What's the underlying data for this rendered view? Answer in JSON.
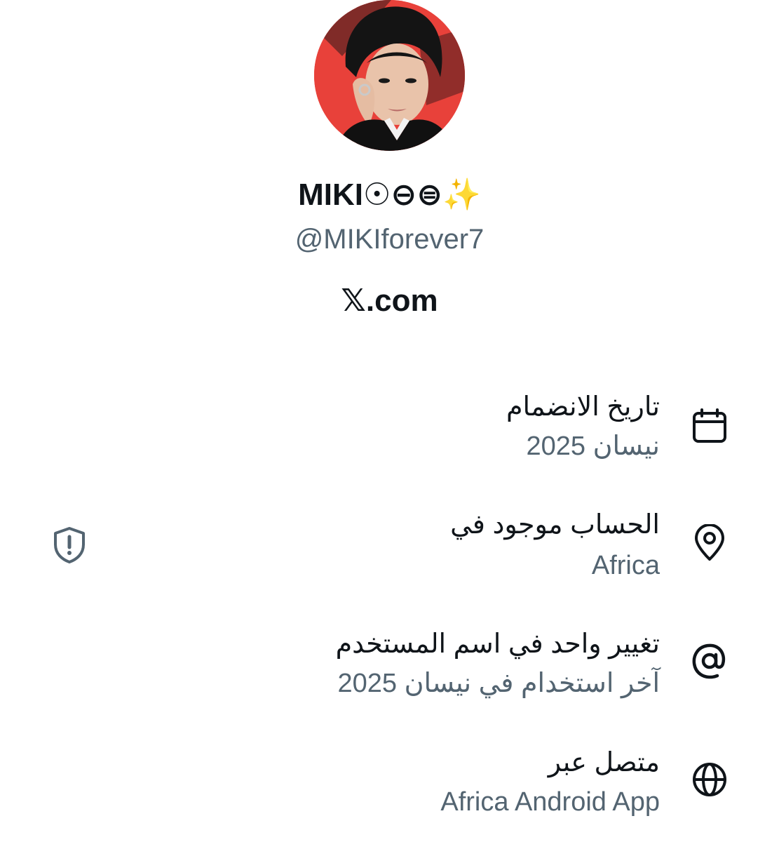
{
  "profile": {
    "display_name": "MIKI☉⊖⊜",
    "sparkles": "✨",
    "handle": "@MIKIforever7",
    "site_domain": "𝕏.com"
  },
  "about": {
    "joined": {
      "label": "تاريخ الانضمام",
      "value": "نيسان 2025",
      "icon": "calendar-icon"
    },
    "location": {
      "label": "الحساب موجود في",
      "value": "Africa",
      "icon": "location-pin-icon",
      "info_icon": "shield-alert-icon"
    },
    "username_change": {
      "label": "تغيير واحد في اسم المستخدم",
      "value": "آخر استخدام في نيسان 2025",
      "icon": "at-sign-icon"
    },
    "connected_via": {
      "label": "متصل عبر",
      "value": "Africa Android App",
      "icon": "globe-icon"
    }
  },
  "colors": {
    "primary_text": "#0f1419",
    "secondary_text": "#536471",
    "avatar_background": "#e8413a"
  }
}
